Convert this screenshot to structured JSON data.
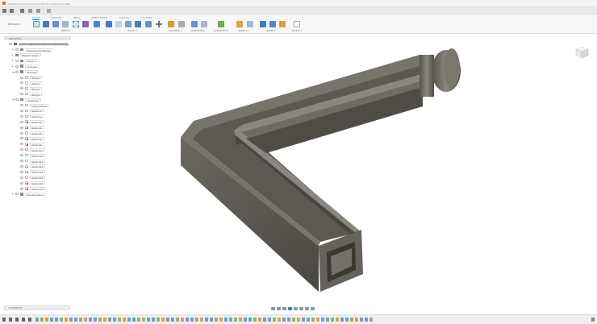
{
  "window": {
    "title": "Autodesk Fusion Personal (Not for Commercial Use)",
    "document_tab": "bladder_ultrasonic_imaging_case v12"
  },
  "ribbon": {
    "workspace": "DESIGN ▾",
    "tabs": [
      {
        "label": "SOLID",
        "active": true
      },
      {
        "label": "SURFACE"
      },
      {
        "label": "MESH"
      },
      {
        "label": "SHEET METAL"
      },
      {
        "label": "PLASTIC"
      },
      {
        "label": "UTILITIES"
      }
    ],
    "groups": [
      "CREATE ▾",
      "MODIFY ▾",
      "ASSEMBLE ▾",
      "CONFIGURE ▾",
      "CONSTRUCT ▾",
      "INSPECT ▾",
      "INSERT ▾",
      "SELECT ▾"
    ]
  },
  "browser": {
    "title": "BROWSER",
    "root": "bladder_ultrasonic_imaging_case v12",
    "items": [
      {
        "label": "Document Settings",
        "level": 1,
        "icon": "gear-icon"
      },
      {
        "label": "Named Views",
        "level": 1,
        "icon": "folder-icon"
      },
      {
        "label": "Origin",
        "level": 1,
        "icon": "folder-icon"
      },
      {
        "label": "Analysis",
        "level": 1,
        "icon": "folder-icon"
      },
      {
        "label": "Bodies",
        "level": 1,
        "icon": "folder-icon",
        "expanded": true
      },
      {
        "label": "Body1",
        "level": 2,
        "icon": "body-icon"
      },
      {
        "label": "Body2",
        "level": 2,
        "icon": "body-icon"
      },
      {
        "label": "Body3",
        "level": 2,
        "icon": "body-icon"
      },
      {
        "label": "Body4",
        "level": 2,
        "icon": "body-icon"
      },
      {
        "label": "Sketches",
        "level": 1,
        "icon": "folder-icon",
        "expanded": true
      },
      {
        "label": "Unit_outline",
        "level": 2,
        "icon": "sketch-icon"
      },
      {
        "label": "Sketch1",
        "level": 2,
        "icon": "sketch-icon"
      },
      {
        "label": "Sketch2",
        "level": 2,
        "icon": "sketch-icon"
      },
      {
        "label": "Sketch3",
        "level": 2,
        "icon": "sketch-icon",
        "error": true
      },
      {
        "label": "Sketch4",
        "level": 2,
        "icon": "sketch-icon",
        "error": true
      },
      {
        "label": "Sketch5",
        "level": 2,
        "icon": "sketch-icon"
      },
      {
        "label": "Sketch6",
        "level": 2,
        "icon": "sketch-icon",
        "error": true
      },
      {
        "label": "Sketch8",
        "level": 2,
        "icon": "sketch-icon",
        "error": true
      },
      {
        "label": "Sketch10",
        "level": 2,
        "icon": "sketch-icon"
      },
      {
        "label": "Sketch11",
        "level": 2,
        "icon": "sketch-icon"
      },
      {
        "label": "Sketch12",
        "level": 2,
        "icon": "sketch-icon"
      },
      {
        "label": "Sketch13",
        "level": 2,
        "icon": "sketch-icon",
        "error": true
      },
      {
        "label": "Sketch14",
        "level": 2,
        "icon": "sketch-icon",
        "error": true
      },
      {
        "label": "Sketch15",
        "level": 2,
        "icon": "sketch-icon"
      },
      {
        "label": "Sketch16",
        "level": 2,
        "icon": "sketch-icon",
        "error": true
      },
      {
        "label": "Sketch17",
        "level": 2,
        "icon": "sketch-icon",
        "error": true
      },
      {
        "label": "Construction",
        "level": 1,
        "icon": "folder-icon"
      }
    ]
  },
  "comments": {
    "label": "COMMENTS"
  },
  "colors": {
    "accent": "#2a7fd4",
    "model": "#5f5c55",
    "title_logo": "#e0602a"
  }
}
